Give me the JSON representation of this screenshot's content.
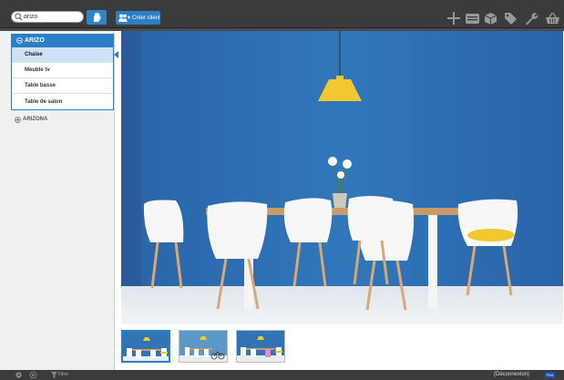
{
  "toolbar": {
    "search": {
      "value": "arizo",
      "placeholder": ""
    },
    "create_client_label": "Créer client",
    "icons": [
      "search-icon",
      "hand-icon",
      "user-plus-icon",
      "plus-icon",
      "list-icon",
      "box-icon",
      "tag-icon",
      "wrench-icon",
      "basket-icon"
    ]
  },
  "sidebar": {
    "groups": [
      {
        "label": "ARIZO",
        "expanded": true,
        "items": [
          {
            "label": "Chaise",
            "active": true
          },
          {
            "label": "Meuble tv",
            "active": false
          },
          {
            "label": "Table basse",
            "active": false
          },
          {
            "label": "Table de salon",
            "active": false
          }
        ]
      },
      {
        "label": "ARIZONA",
        "expanded": false,
        "items": []
      }
    ]
  },
  "gallery": {
    "thumb_count": 3,
    "active_thumb": 0
  },
  "footer": {
    "filter_label": "Filtre",
    "logout_label": "(Déconnexion)",
    "lang_label": "FRA"
  },
  "colors": {
    "toolbar_bg": "#3b3b3b",
    "accent": "#2b7fc4",
    "wall": "#2a5fa3"
  }
}
